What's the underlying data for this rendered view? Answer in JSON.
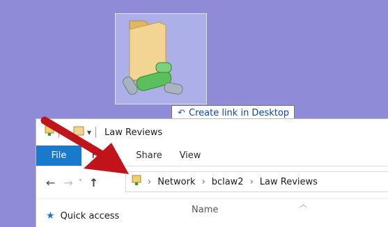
{
  "desktop": {
    "background_color": "#8f8bd7",
    "icon": {
      "name": "network-shortcut-folder-icon"
    }
  },
  "drag_tooltip": {
    "icon": "link-arrow-icon",
    "text": "Create link in Desktop"
  },
  "explorer": {
    "title": "Law Reviews",
    "qat_icons": [
      "properties-icon",
      "new-folder-icon",
      "qat-dropdown-icon"
    ],
    "ribbon_tabs": [
      "File",
      "Home",
      "Share",
      "View"
    ],
    "file_tab_color": "#1979ca",
    "nav": {
      "back": "←",
      "forward": "→",
      "recent": "˅",
      "up": "↑"
    },
    "address_path": [
      "Network",
      "bclaw2",
      "Law Reviews"
    ],
    "sidebar": {
      "quick_access": "Quick access"
    },
    "columns": {
      "name": "Name"
    }
  },
  "annotation": {
    "arrow_color": "#c0141a"
  }
}
